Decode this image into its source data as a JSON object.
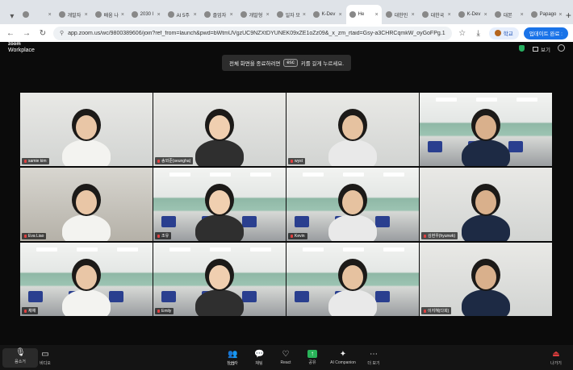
{
  "browser": {
    "tabs": [
      {
        "label": "",
        "active": false
      },
      {
        "label": "개발자",
        "active": false
      },
      {
        "label": "배움 나",
        "active": false
      },
      {
        "label": "2030 l",
        "active": false
      },
      {
        "label": "AI 5주",
        "active": false
      },
      {
        "label": "졸업자",
        "active": false
      },
      {
        "label": "개발형",
        "active": false
      },
      {
        "label": "일자 모",
        "active": false
      },
      {
        "label": "K-Dev",
        "active": false
      },
      {
        "label": "He",
        "active": true
      },
      {
        "label": "대한민",
        "active": false
      },
      {
        "label": "대한국",
        "active": false
      },
      {
        "label": "K-Dev",
        "active": false
      },
      {
        "label": "대본",
        "active": false
      },
      {
        "label": "Papago",
        "active": false
      }
    ],
    "url": "app.zoom.us/wc/9800389606/join?ref_from=launch&pwd=bWtmUVgzUC9NZXtDYUNEK09xZE1oZz09&_x_zm_rtaid=Gsy-a3CHRCqmkW_oyGoFPg.1780276669159.7ca7b09f80e7b...",
    "profile_label": "학교",
    "update_label": "업데이트 완료 :"
  },
  "zoom": {
    "logo_top": "zoom",
    "logo_bottom": "Workplace",
    "view_label": "보기",
    "banner_text": "전체 화면을 종료하려면",
    "banner_key": "esc",
    "banner_suffix": "키를 길게 누르세요."
  },
  "participants": [
    {
      "name": "samie kim",
      "bg": "wall"
    },
    {
      "name": "송외준(seungha)",
      "bg": "wall"
    },
    {
      "name": "wyst",
      "bg": "wall"
    },
    {
      "name": "",
      "bg": "class"
    },
    {
      "name": "Eva Liao",
      "bg": "dark"
    },
    {
      "name": "조유",
      "bg": "class"
    },
    {
      "name": "Kevin",
      "bg": "class"
    },
    {
      "name": "김현우(hyunwk)",
      "bg": "wall"
    },
    {
      "name": "채채",
      "bg": "class"
    },
    {
      "name": "Emily",
      "bg": "class"
    },
    {
      "name": "",
      "bg": "class"
    },
    {
      "name": "이지혜(다희)",
      "bg": "wall"
    }
  ],
  "controls": {
    "audio": "음소거",
    "video": "비디오",
    "participants": "참가자",
    "participants_count": "22",
    "chat": "채팅",
    "react": "React",
    "share": "공유",
    "ai": "AI Companion",
    "more": "더 보기",
    "leave": "나가기"
  },
  "colors": {
    "share_green": "#29b359",
    "leave_red": "#e23e3e",
    "url_blue": "#1a73e8"
  }
}
